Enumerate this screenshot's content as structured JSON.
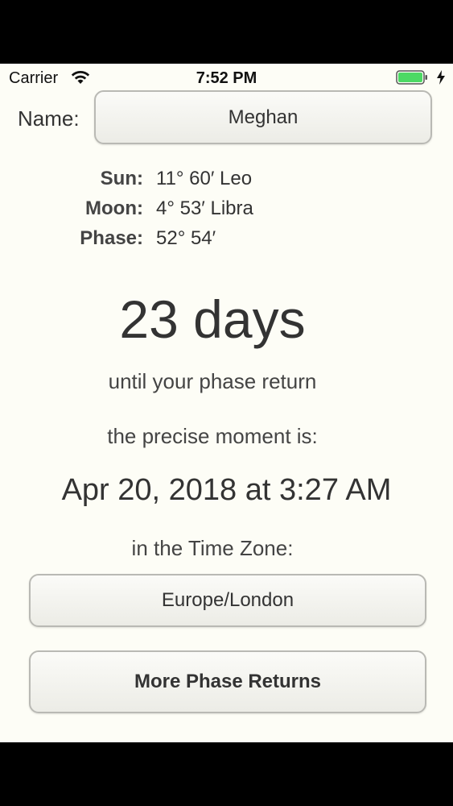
{
  "status_bar": {
    "carrier": "Carrier",
    "time": "7:52 PM",
    "wifi_icon": "wifi-icon",
    "battery_icon": "battery-charging-icon",
    "battery_color": "#4cd964"
  },
  "name_row": {
    "label": "Name:",
    "value": "Meghan"
  },
  "positions": [
    {
      "label": "Sun:",
      "value": "11° 60′ Leo"
    },
    {
      "label": "Moon:",
      "value": "4° 53′ Libra"
    },
    {
      "label": "Phase:",
      "value": "52° 54′"
    }
  ],
  "countdown": {
    "days": "23 days",
    "caption": "until your phase return",
    "moment_caption": "the precise moment is:",
    "moment": "Apr 20, 2018 at 3:27 AM",
    "timezone_caption": "in the Time Zone:"
  },
  "timezone_button": {
    "label": "Europe/London"
  },
  "more_button": {
    "label": "More Phase Returns"
  },
  "colors": {
    "background": "#fdfdf6",
    "text": "#333333"
  }
}
